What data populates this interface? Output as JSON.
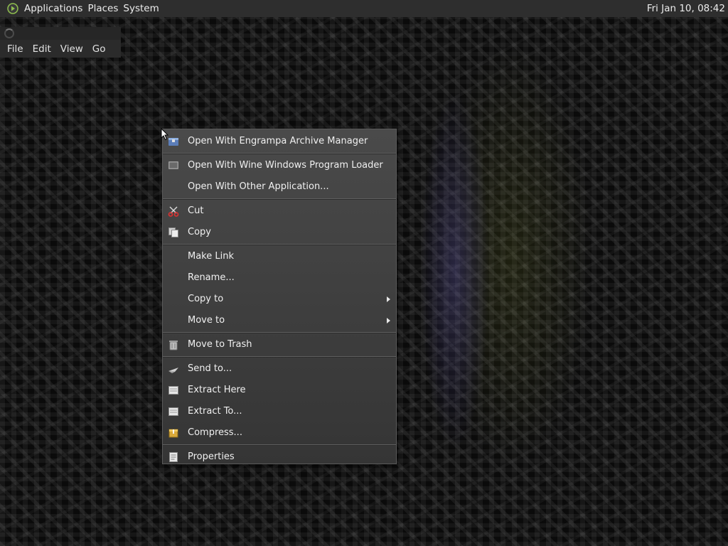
{
  "top_panel": {
    "menus": [
      "Applications",
      "Places",
      "System"
    ],
    "clock": "Fri Jan 10, 08:42"
  },
  "file_manager": {
    "menubar": [
      "File",
      "Edit",
      "View",
      "Go"
    ]
  },
  "context_menu": {
    "items": [
      {
        "label": "Open With Engrampa Archive Manager",
        "icon": "archive-manager-icon"
      },
      {
        "label": "Open With Wine Windows Program Loader",
        "icon": "wine-icon"
      },
      {
        "label": "Open With Other Application...",
        "icon": ""
      },
      {
        "label": "Cut",
        "icon": "scissors-icon"
      },
      {
        "label": "Copy",
        "icon": "copy-icon"
      },
      {
        "label": "Make Link",
        "icon": ""
      },
      {
        "label": "Rename...",
        "icon": ""
      },
      {
        "label": "Copy to",
        "icon": "",
        "submenu": true
      },
      {
        "label": "Move to",
        "icon": "",
        "submenu": true
      },
      {
        "label": "Move to Trash",
        "icon": "trash-icon"
      },
      {
        "label": "Send to...",
        "icon": "send-icon"
      },
      {
        "label": "Extract Here",
        "icon": "extract-icon"
      },
      {
        "label": "Extract To...",
        "icon": "extract-icon"
      },
      {
        "label": "Compress...",
        "icon": "compress-icon"
      },
      {
        "label": "Properties",
        "icon": "properties-icon"
      }
    ]
  },
  "colors": {
    "panel_bg": "#2e2e2e",
    "menu_bg": "#424242",
    "text": "#f0f0f0"
  }
}
